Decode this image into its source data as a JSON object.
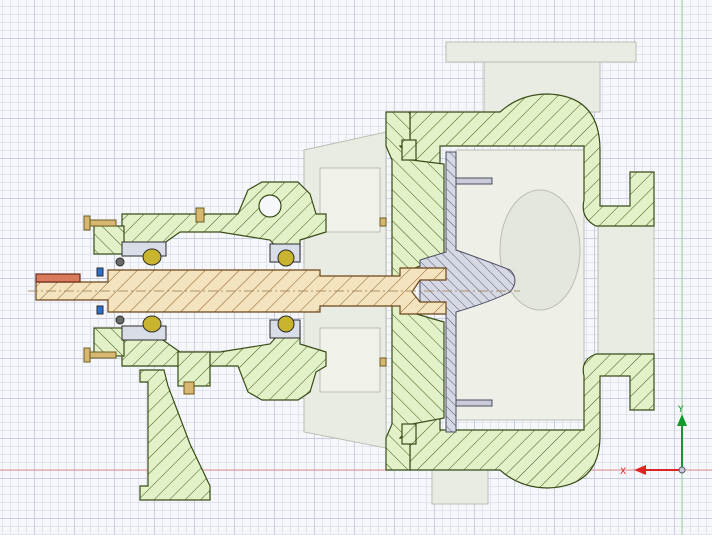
{
  "triad": {
    "x_label": "X",
    "y_label": "Y",
    "x_color": "#e02424",
    "y_color": "#119a2a"
  },
  "colors": {
    "section_fill": "#e3f1c9",
    "section_stroke": "#3a4d18",
    "hatch": "#3d5a14",
    "shaft_fill": "#f4e3bf",
    "shaft_hatch": "#8a5a20",
    "impeller_fill": "#d6d8e4",
    "impeller_hatch": "#55596e",
    "ghost_fill": "#e9ece2",
    "ghost_stroke": "#b8bcb0",
    "origin_line": "#e88c8c"
  }
}
